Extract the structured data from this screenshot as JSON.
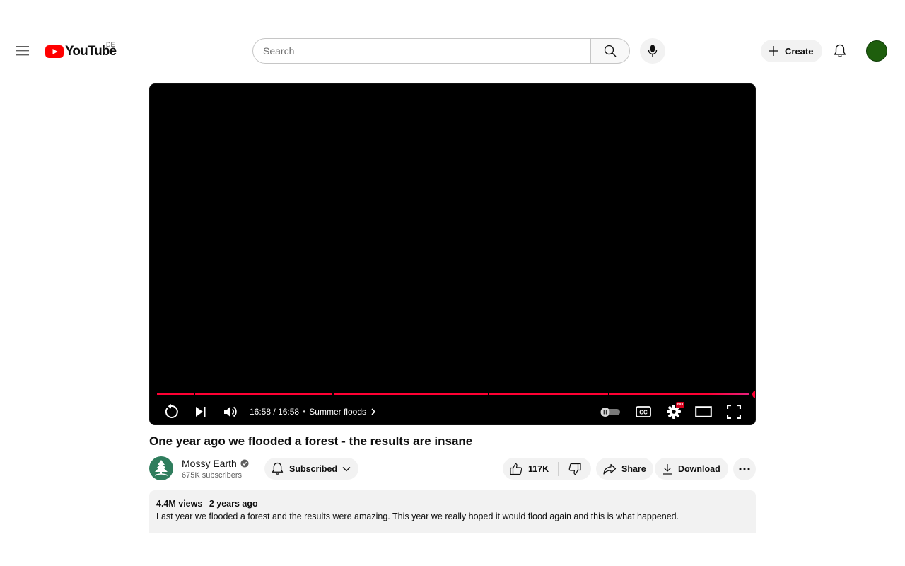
{
  "masthead": {
    "logo_text": "YouTube",
    "country_code": "DE",
    "search_placeholder": "Search",
    "create_label": "Create",
    "avatar_color": "#1e5e0d"
  },
  "player": {
    "current_time": "16:58",
    "separator": "/",
    "duration": "16:58",
    "chapter": "Summer floods",
    "progress": 1.0,
    "progress_color": "#ff0033",
    "hd_badge": "HD",
    "icons": [
      "replay-icon",
      "next-icon",
      "volume-icon",
      "autoplay-toggle",
      "captions-icon",
      "settings-icon",
      "theater-mode-icon",
      "fullscreen-icon"
    ]
  },
  "video": {
    "title": "One year ago we flooded a forest - the results are insane"
  },
  "owner": {
    "channel_name": "Mossy Earth",
    "subscribers": "675K subscribers",
    "subscribe_state": "Subscribed"
  },
  "actions": {
    "likes": "117K",
    "share_label": "Share",
    "download_label": "Download"
  },
  "description": {
    "views": "4.4M views",
    "date": "2 years ago",
    "text": "Last year we flooded a forest and the results were amazing. This year we really hoped it would flood again and this is what happened."
  }
}
